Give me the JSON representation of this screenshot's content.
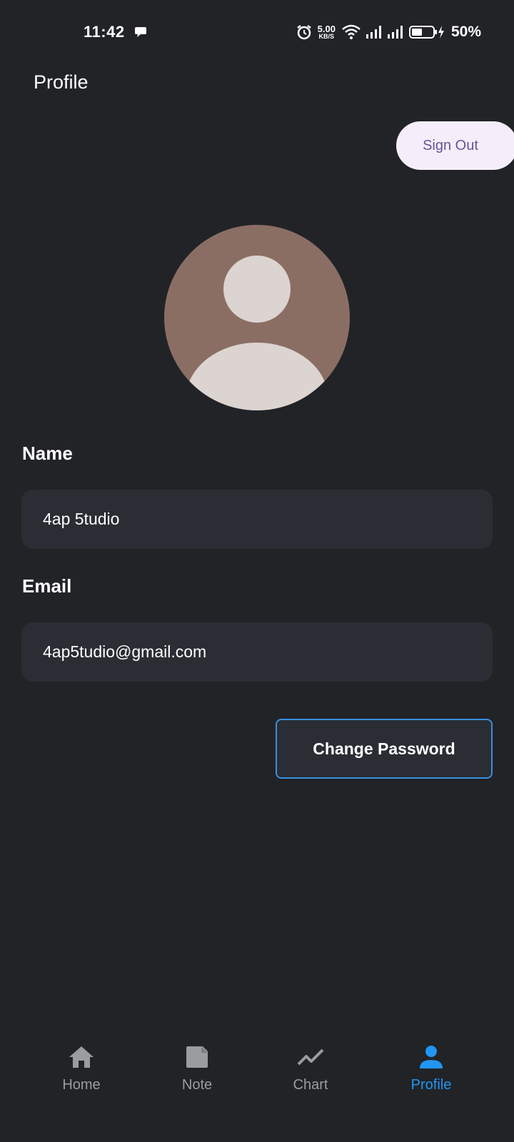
{
  "status_bar": {
    "time": "11:42",
    "net_speed_value": "5.00",
    "net_speed_unit": "KB/S",
    "battery": "50%"
  },
  "header": {
    "title": "Profile",
    "sign_out_label": "Sign Out"
  },
  "profile": {
    "name_label": "Name",
    "name_value": "4ap 5tudio",
    "email_label": "Email",
    "email_value": "4ap5tudio@gmail.com",
    "change_password_label": "Change Password"
  },
  "nav": {
    "items": [
      {
        "label": "Home",
        "icon": "home-icon"
      },
      {
        "label": "Note",
        "icon": "note-icon"
      },
      {
        "label": "Chart",
        "icon": "chart-icon"
      },
      {
        "label": "Profile",
        "icon": "person-icon",
        "active": true
      }
    ]
  },
  "colors": {
    "background": "#212327",
    "field": "#2a2d33",
    "accent": "#2196f3",
    "sign_out_bg": "#f5eefa",
    "sign_out_text": "#6a5197",
    "avatar_bg": "#8b6e63"
  }
}
